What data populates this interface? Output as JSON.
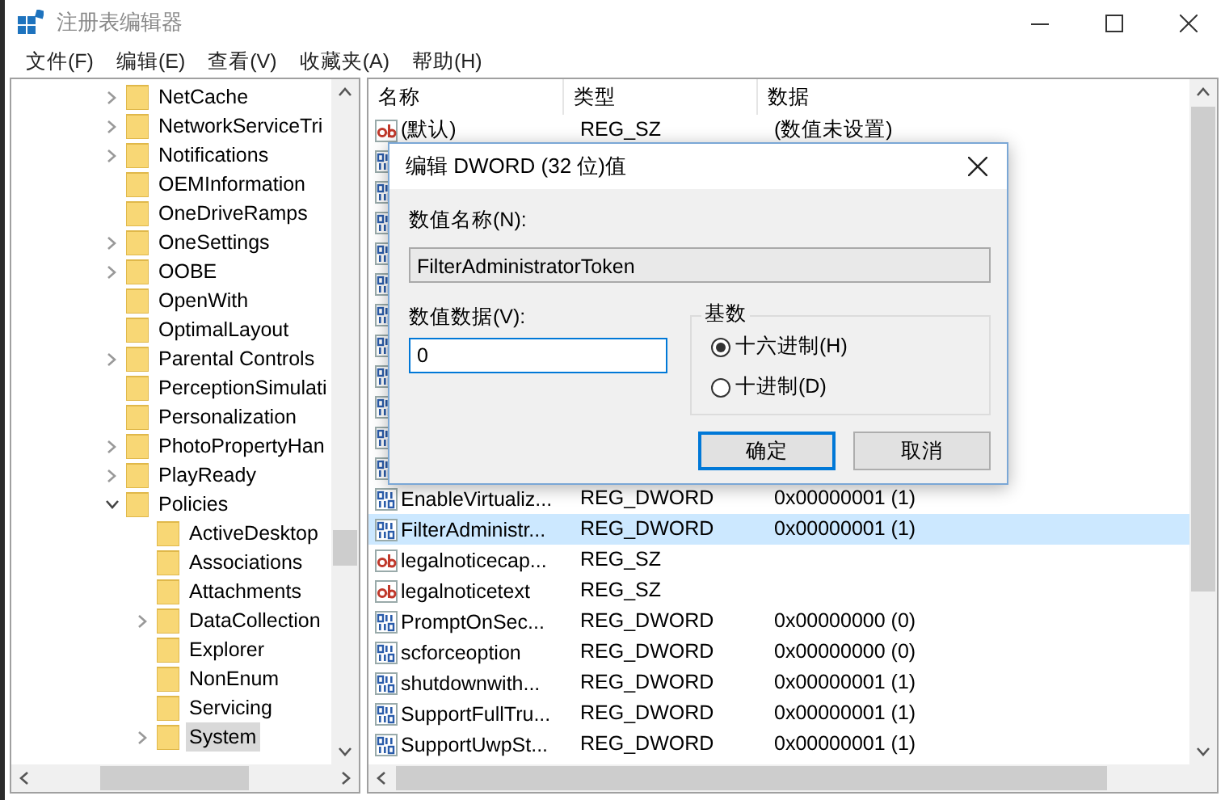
{
  "window": {
    "title": "注册表编辑器"
  },
  "menu": [
    "文件(F)",
    "编辑(E)",
    "查看(V)",
    "收藏夹(A)",
    "帮助(H)"
  ],
  "tree": [
    {
      "label": "NetCache",
      "expanded": false,
      "selected": false
    },
    {
      "label": "NetworkServiceTri",
      "expanded": false,
      "selected": false
    },
    {
      "label": "Notifications",
      "expanded": false,
      "selected": false
    },
    {
      "label": "OEMInformation",
      "selected": false
    },
    {
      "label": "OneDriveRamps",
      "selected": false
    },
    {
      "label": "OneSettings",
      "expanded": false,
      "selected": false
    },
    {
      "label": "OOBE",
      "expanded": false,
      "selected": false
    },
    {
      "label": "OpenWith",
      "selected": false
    },
    {
      "label": "OptimalLayout",
      "selected": false
    },
    {
      "label": "Parental Controls",
      "expanded": false,
      "selected": false
    },
    {
      "label": "PerceptionSimulati",
      "selected": false
    },
    {
      "label": "Personalization",
      "selected": false
    },
    {
      "label": "PhotoPropertyHan",
      "expanded": false,
      "selected": false
    },
    {
      "label": "PlayReady",
      "expanded": false,
      "selected": false
    },
    {
      "label": "Policies",
      "expanded": true,
      "selected": false,
      "children": [
        {
          "label": "ActiveDesktop",
          "selected": false
        },
        {
          "label": "Associations",
          "selected": false
        },
        {
          "label": "Attachments",
          "selected": false
        },
        {
          "label": "DataCollection",
          "expanded": false,
          "selected": false
        },
        {
          "label": "Explorer",
          "selected": false
        },
        {
          "label": "NonEnum",
          "selected": false
        },
        {
          "label": "Servicing",
          "selected": false
        },
        {
          "label": "System",
          "expanded": false,
          "selected": true
        }
      ]
    }
  ],
  "table": {
    "columns": [
      "名称",
      "类型",
      "数据"
    ],
    "rows": [
      {
        "kind": "sz",
        "name": "(默认)",
        "type": "REG_SZ",
        "data": "(数值未设置)",
        "selected": false
      },
      {
        "kind": "dword",
        "selected": false
      },
      {
        "kind": "dword",
        "selected": false
      },
      {
        "kind": "dword",
        "selected": false
      },
      {
        "kind": "dword",
        "selected": false
      },
      {
        "kind": "dword",
        "selected": false
      },
      {
        "kind": "dword",
        "selected": false
      },
      {
        "kind": "dword",
        "selected": false
      },
      {
        "kind": "dword",
        "selected": false
      },
      {
        "kind": "dword",
        "selected": false
      },
      {
        "kind": "dword",
        "selected": false
      },
      {
        "kind": "dword",
        "selected": false
      },
      {
        "kind": "dword",
        "name": "EnableVirtualiz...",
        "type": "REG_DWORD",
        "data": "0x00000001 (1)",
        "selected": false
      },
      {
        "kind": "dword",
        "name": "FilterAdministr...",
        "type": "REG_DWORD",
        "data": "0x00000001 (1)",
        "selected": true
      },
      {
        "kind": "sz",
        "name": "legalnoticecap...",
        "type": "REG_SZ",
        "selected": false
      },
      {
        "kind": "sz",
        "name": "legalnoticetext",
        "type": "REG_SZ",
        "selected": false
      },
      {
        "kind": "dword",
        "name": "PromptOnSec...",
        "type": "REG_DWORD",
        "data": "0x00000000 (0)",
        "selected": false
      },
      {
        "kind": "dword",
        "name": "scforceoption",
        "type": "REG_DWORD",
        "data": "0x00000000 (0)",
        "selected": false
      },
      {
        "kind": "dword",
        "name": "shutdownwith...",
        "type": "REG_DWORD",
        "data": "0x00000001 (1)",
        "selected": false
      },
      {
        "kind": "dword",
        "name": "SupportFullTru...",
        "type": "REG_DWORD",
        "data": "0x00000001 (1)",
        "selected": false
      },
      {
        "kind": "dword",
        "name": "SupportUwpSt...",
        "type": "REG_DWORD",
        "data": "0x00000001 (1)",
        "selected": false
      }
    ]
  },
  "dialog": {
    "title": "编辑 DWORD (32 位)值",
    "name_label": "数值名称(N):",
    "name_value": "FilterAdministratorToken",
    "data_label": "数值数据(V):",
    "data_value": "0",
    "base_label": "基数",
    "radios": [
      {
        "label": "十六进制(H)",
        "selected": true
      },
      {
        "label": "十进制(D)",
        "selected": false
      }
    ],
    "buttons": [
      {
        "label": "确定",
        "default": true
      },
      {
        "label": "取消",
        "default": false
      }
    ]
  }
}
